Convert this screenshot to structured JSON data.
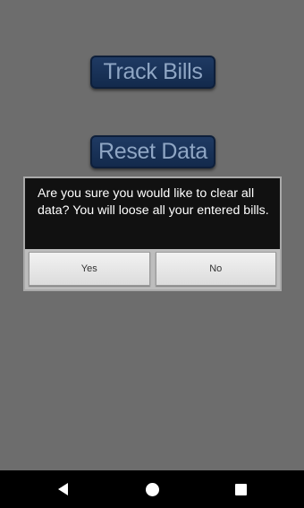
{
  "main": {
    "track_bills_label": "Track Bills",
    "reset_data_label": "Reset Data"
  },
  "dialog": {
    "message": "Are you sure you would like to clear all data? You will loose all your entered bills.",
    "yes_label": "Yes",
    "no_label": "No"
  },
  "nav": {
    "back_icon": "back-triangle-icon",
    "home_icon": "home-circle-icon",
    "recents_icon": "recents-square-icon"
  },
  "colors": {
    "background": "#6d6d6d",
    "button_fill": "#1f3a63",
    "button_text": "#8fa6c4",
    "dialog_background": "#111111",
    "nav_bar": "#000000"
  }
}
